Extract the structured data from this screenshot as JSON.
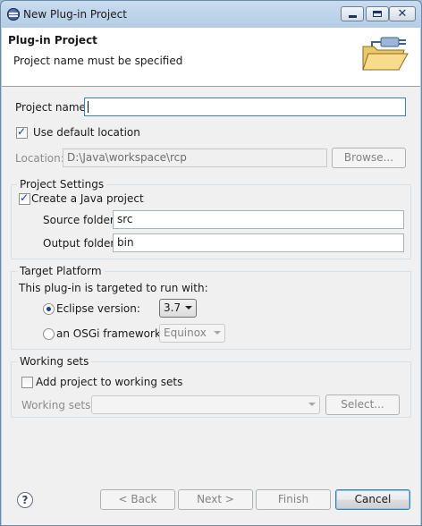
{
  "window": {
    "title": "New Plug-in Project",
    "close_glyph": "✕"
  },
  "header": {
    "title": "Plug-in Project",
    "message": "Project name must be specified",
    "banner_icon": "plugin-folder-icon"
  },
  "form": {
    "project_name_label": "Project name:",
    "project_name_value": "",
    "use_default_label": "Use default location",
    "use_default_checked": true,
    "location_label": "Location:",
    "location_value": "D:\\Java\\workspace\\rcp",
    "browse_label": "Browse..."
  },
  "project_settings": {
    "title": "Project Settings",
    "create_java_label": "Create a Java project",
    "create_java_checked": true,
    "source_folder_label": "Source folder:",
    "source_folder_value": "src",
    "output_folder_label": "Output folder:",
    "output_folder_value": "bin"
  },
  "target_platform": {
    "title": "Target Platform",
    "intro": "This plug-in is targeted to run with:",
    "eclipse_label": "Eclipse version:",
    "eclipse_selected": true,
    "eclipse_version": "3.7",
    "osgi_label": "an OSGi framework:",
    "osgi_value": "Equinox"
  },
  "working_sets": {
    "title": "Working sets",
    "add_label": "Add project to working sets",
    "add_checked": false,
    "sets_label": "Working sets:",
    "sets_value": "",
    "select_label": "Select..."
  },
  "footer": {
    "help_glyph": "?",
    "back_label": "< Back",
    "next_label": "Next >",
    "finish_label": "Finish",
    "cancel_label": "Cancel"
  }
}
